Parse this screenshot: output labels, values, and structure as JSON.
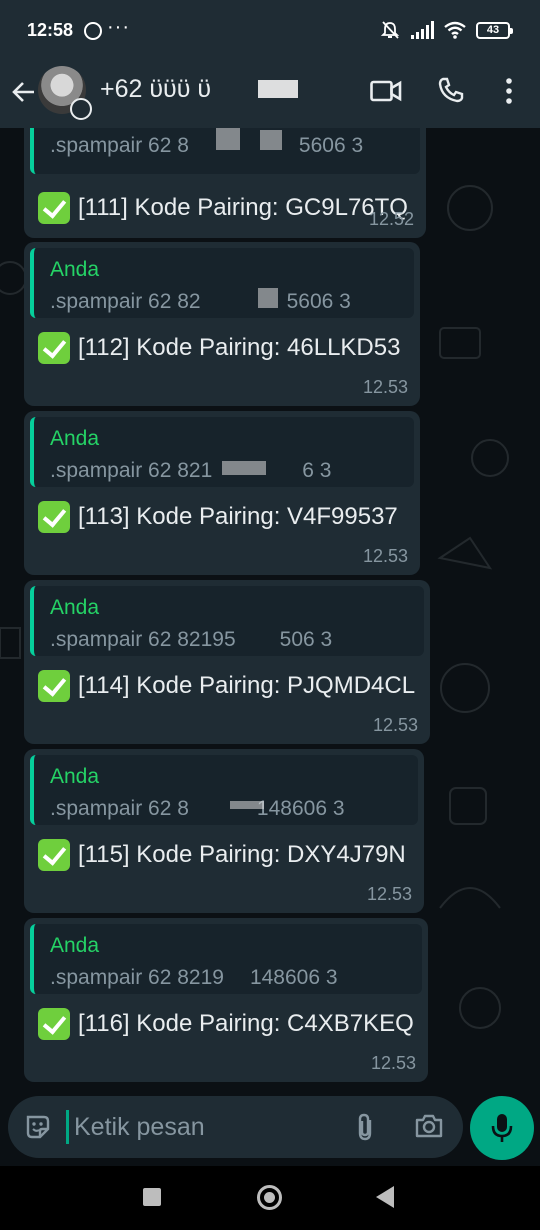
{
  "status_bar": {
    "time": "12:58",
    "battery": "43",
    "notification_icons": [
      "whatsapp-icon",
      "more-dots-icon"
    ],
    "system_icons": [
      "mute-icon",
      "signal-icon",
      "wifi-icon",
      "battery-icon"
    ]
  },
  "header": {
    "contact_name": "+62 ϋϋϋ ϋ",
    "icons": [
      "back-arrow-icon",
      "video-call-icon",
      "voice-call-icon",
      "overflow-menu-icon"
    ]
  },
  "messages": [
    {
      "quote_text": ".spampair 62 8",
      "quote_text_tail": "5606 3",
      "text": "[111] Kode Pairing: GC9L76TQ",
      "time": "12.52"
    },
    {
      "quote_author": "Anda",
      "quote_text": ".spampair 62 82",
      "quote_text_tail": "5606 3",
      "text": "[112] Kode Pairing: 46LLKD53",
      "time": "12.53"
    },
    {
      "quote_author": "Anda",
      "quote_text": ".spampair 62 821",
      "quote_text_tail": "6 3",
      "text": "[113] Kode Pairing: V4F99537",
      "time": "12.53"
    },
    {
      "quote_author": "Anda",
      "quote_text": ".spampair 62 82195",
      "quote_text_tail": "506 3",
      "text": "[114] Kode Pairing: PJQMD4CL",
      "time": "12.53"
    },
    {
      "quote_author": "Anda",
      "quote_text": ".spampair 62 8",
      "quote_text_tail": "148606 3",
      "text": "[115] Kode Pairing: DXY4J79N",
      "time": "12.53"
    },
    {
      "quote_author": "Anda",
      "quote_text": ".spampair 62 8219",
      "quote_text_tail": "148606 3",
      "text": "[116] Kode Pairing: C4XB7KEQ",
      "time": "12.53"
    }
  ],
  "composer": {
    "placeholder": "Ketik pesan"
  },
  "colors": {
    "header_bg": "#1f2c34",
    "chat_bg": "#0b1014",
    "bubble_bg": "#1f2c34",
    "accent_green": "#00a884",
    "author_green": "#25d366",
    "meta_gray": "#8696a0"
  }
}
